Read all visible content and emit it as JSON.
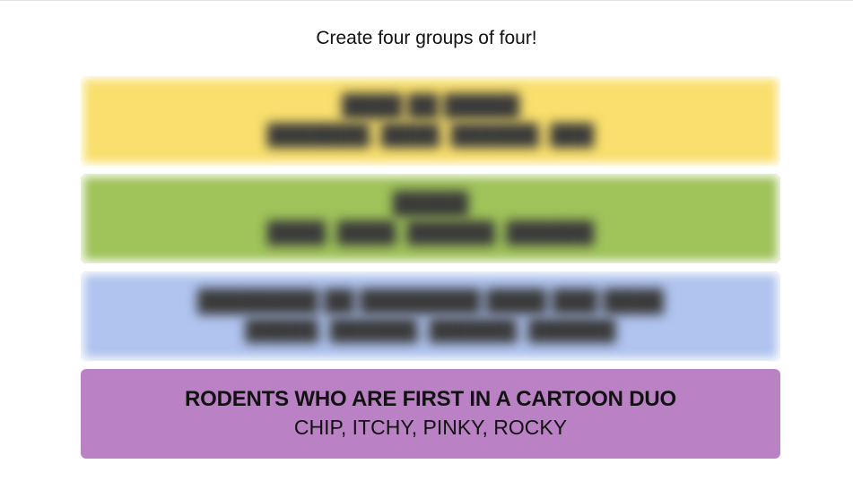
{
  "instructions": "Create four groups of four!",
  "groups": [
    {
      "title": "████ ██ █████",
      "members": "███████, ████, ██████, ███",
      "color": "#f9df6d",
      "blurred": true
    },
    {
      "title": "█████",
      "members": "████, ████, ██████, ██████",
      "color": "#a0c35a",
      "blurred": true
    },
    {
      "title": "████████ ██ ████████ ████ ███ ████",
      "members": "█████, ██████, ██████, ██████",
      "color": "#b0c4ef",
      "blurred": true
    },
    {
      "title": "RODENTS WHO ARE FIRST IN A CARTOON DUO",
      "members": "CHIP, ITCHY, PINKY, ROCKY",
      "color": "#ba81c5",
      "blurred": false
    }
  ]
}
